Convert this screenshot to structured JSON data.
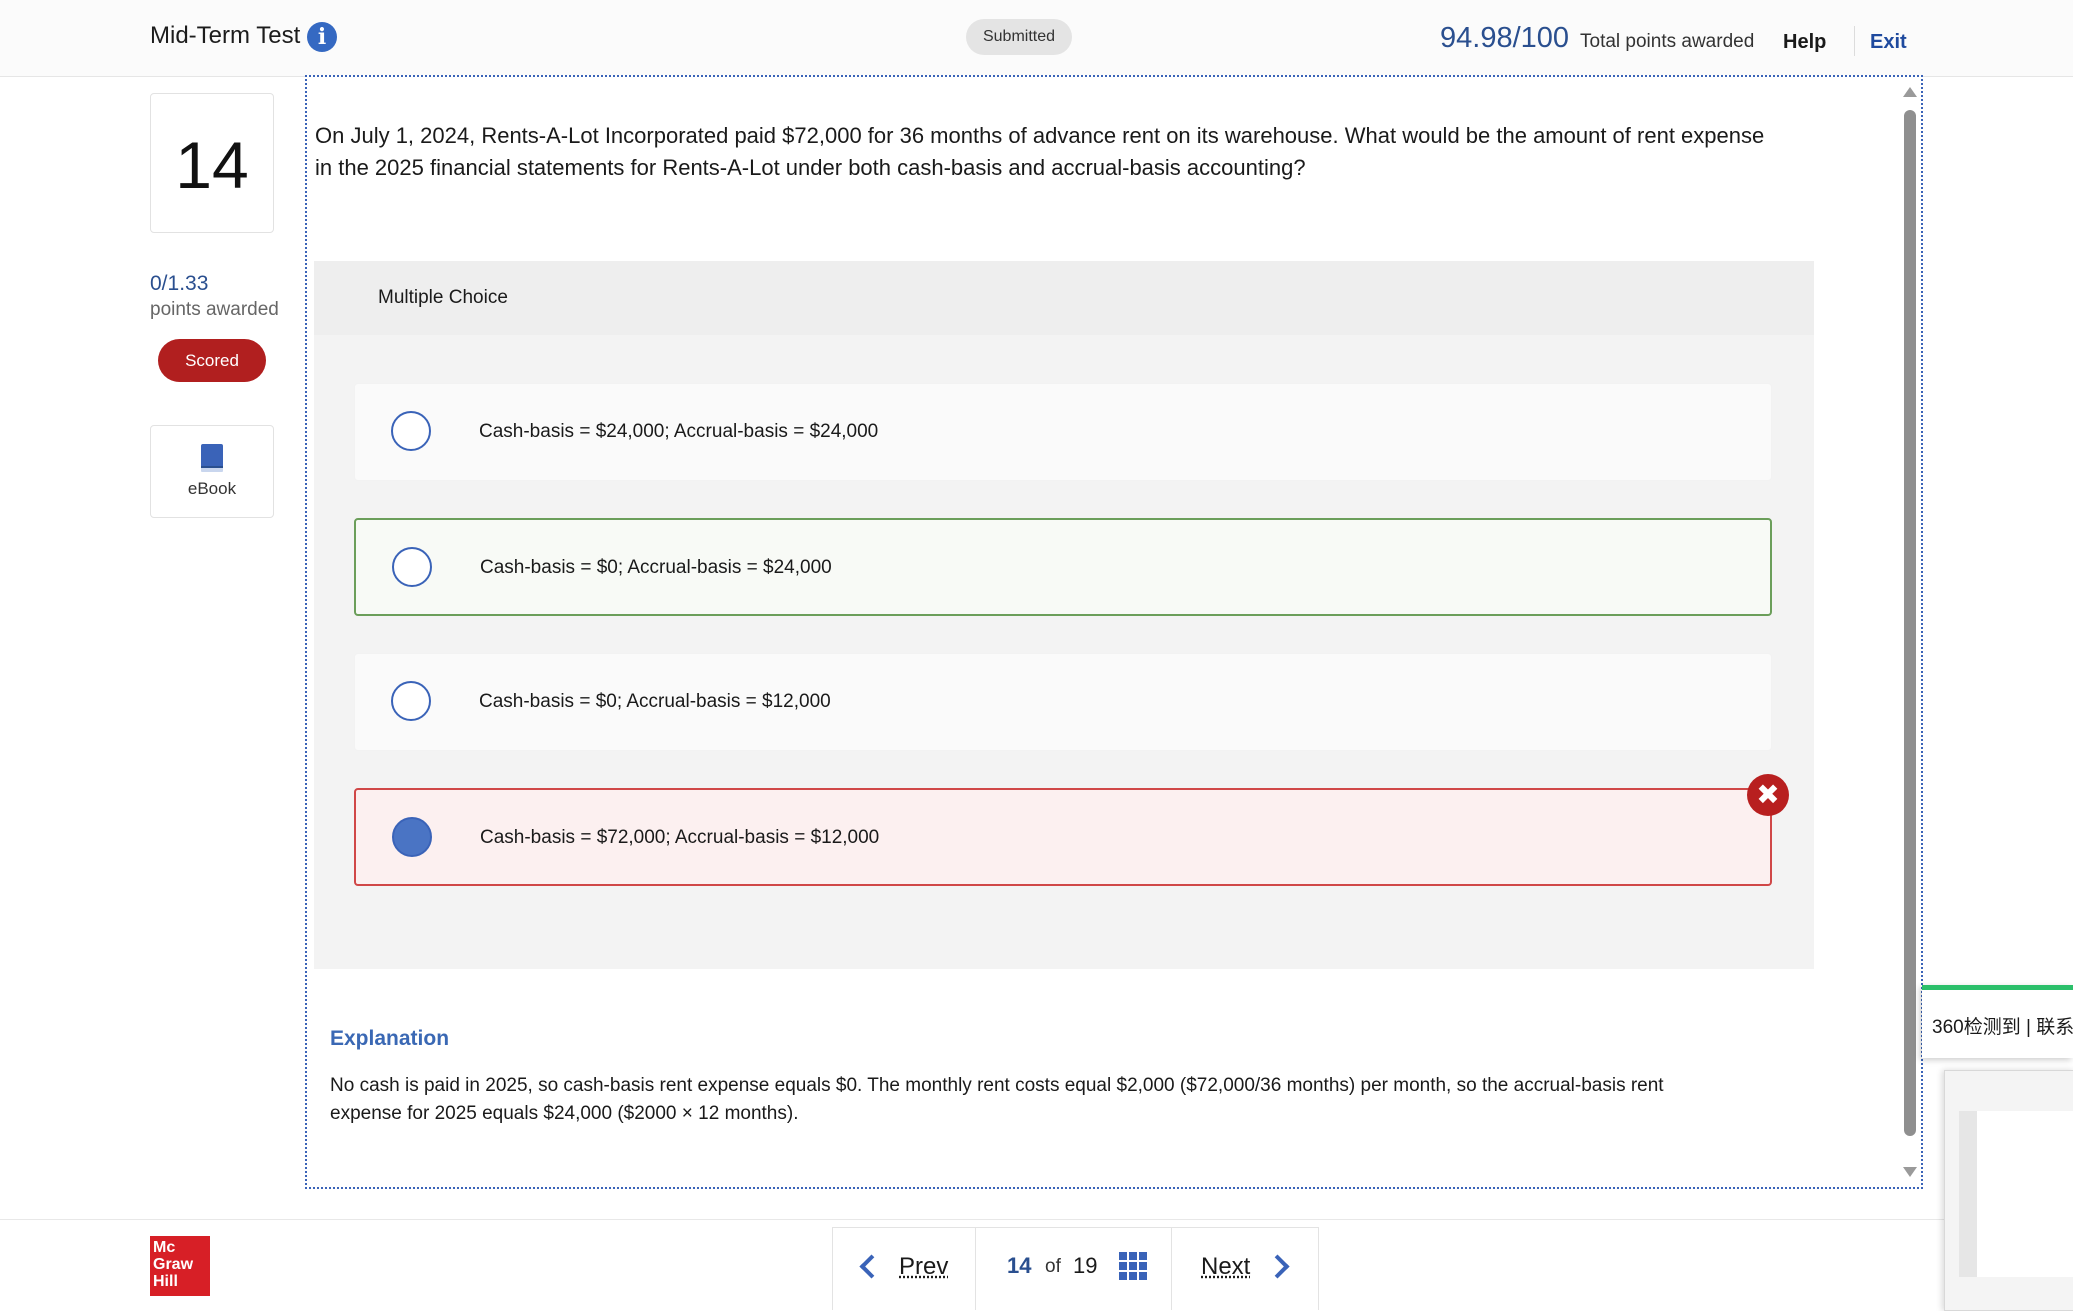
{
  "header": {
    "title": "Mid-Term Test",
    "status_badge": "Submitted",
    "score": "94.98/100",
    "score_label": "Total points awarded",
    "help": "Help",
    "exit": "Exit"
  },
  "sidebar": {
    "question_number": "14",
    "points": "0/1.33",
    "points_label": "points awarded",
    "scored_badge": "Scored",
    "ebook_label": "eBook"
  },
  "question": {
    "text": "On July 1, 2024, Rents-A-Lot Incorporated paid $72,000 for 36 months of advance rent on its warehouse. What would be the amount of rent expense in the 2025 financial statements for Rents-A-Lot under both cash-basis and accrual-basis accounting?",
    "type_label": "Multiple Choice",
    "choices": [
      {
        "label": "Cash-basis = $24,000; Accrual-basis = $24,000",
        "state": "none"
      },
      {
        "label": "Cash-basis = $0; Accrual-basis = $24,000",
        "state": "correct"
      },
      {
        "label": "Cash-basis = $0; Accrual-basis = $12,000",
        "state": "none"
      },
      {
        "label": "Cash-basis = $72,000; Accrual-basis = $12,000",
        "state": "selected-wrong"
      }
    ]
  },
  "explanation": {
    "title": "Explanation",
    "text": "No cash is paid in 2025, so cash-basis rent expense equals $0. The monthly rent costs equal $2,000 ($72,000/36 months) per month, so the accrual-basis rent expense for 2025 equals $24,000 ($2000 × 12 months)."
  },
  "footer": {
    "logo": "Mc Graw Hill",
    "prev": "Prev",
    "current_page": "14",
    "of": "of",
    "total_pages": "19",
    "next": "Next"
  },
  "overlay": {
    "popup_text": "360检测到 | 联系"
  },
  "colors": {
    "accent": "#3a63b8",
    "score_blue": "#2a4f8f",
    "scored_red": "#b11f1f",
    "correct_green": "#6b9e5a",
    "wrong_red": "#d04747",
    "brand_red": "#d71f26"
  },
  "icons": {
    "info": "info-icon",
    "ebook": "book-icon",
    "wrong": "close-icon",
    "grid": "grid-icon"
  }
}
